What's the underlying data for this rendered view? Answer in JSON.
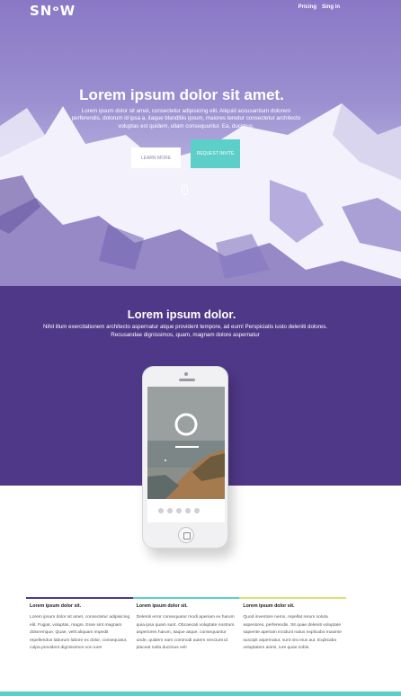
{
  "nav": {
    "logo": "SNᵒW",
    "links": [
      "Pricing",
      "Sing in"
    ]
  },
  "hero": {
    "title": "Lorem ipsum dolor sit amet.",
    "subtitle": "Lorem ipsum dolor sit amet, consectetur adipisicing elit. Aliquid accusantium dolorem perferendis, dolorum id ipsa a, itaque blanditiis ipsum, maiores tenetur consectetur architecto voluptas est quidem, ullam consequuntur. Ea, ducimus.",
    "learn_more": "LEARN MORE",
    "request_invite": "REQUEST INVITE"
  },
  "section": {
    "title": "Lorem ipsum dolor.",
    "subtitle": "Nihil illum exercitationem architecto aspernatur atque provident tempore, ad eum! Perspiciatis iusto deleniti dolores. Recusandae dignissimos, quam, magnam dolore aspernatur"
  },
  "features": [
    {
      "title": "Lorem ipsum dolor sit.",
      "text": "Lorem ipsum dolor sit amet, consectetur adipisicing elit. Fugiat, voluptas, magni. Esse sint magnam doloremque. Quae, velit aliquam impedit repellendus laborum labore ex dolor, consequatur, culpa provident dignissimos non iure!",
      "accent": "#4f3887"
    },
    {
      "title": "Lorem ipsum dolor sit.",
      "text": "Deleniti error consequatur modi aperiam ex harum quia ipsa quam sunt. Obcaecati voluptate nostrum asperiores harum, itaque atque, consequuntur unde, quidem nam commodi autem nesciunt id placeat nulla ducimus vel!",
      "accent": "#5ccfc9"
    },
    {
      "title": "Lorem ipsum dolor sit.",
      "text": "Quod inventore nemo, repellat rerum soluta asperiores, perferendis. Sit quae deleniti voluptate sapiente aperiam incidunt natus explicabo maxime suscipit aspernatur, sunt nisi eius aut. Explicabo voluptatem animi, iure quas nobis.",
      "accent": "#d9e27c"
    }
  ],
  "colors": {
    "brand_purple": "#4f3887",
    "accent_teal": "#5ccfc9"
  }
}
